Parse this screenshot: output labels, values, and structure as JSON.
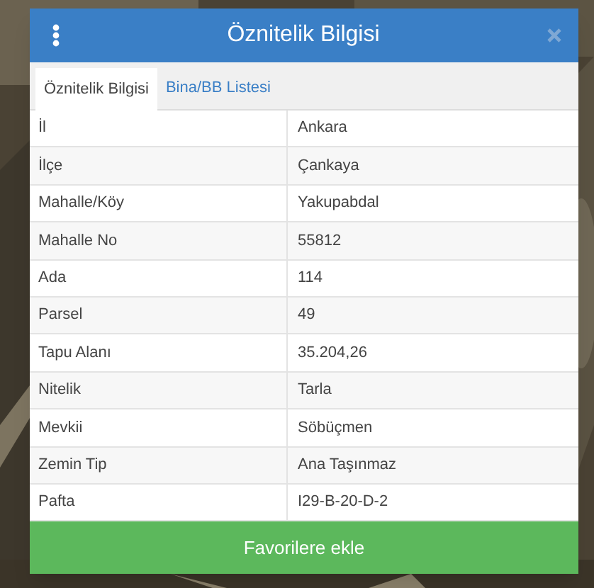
{
  "dialog": {
    "title": "Öznitelik Bilgisi"
  },
  "tabs": [
    {
      "label": "Öznitelik Bilgisi",
      "selected": true
    },
    {
      "label": "Bina/BB Listesi",
      "selected": false
    }
  ],
  "table": {
    "rows": [
      {
        "label": "İl",
        "value": "Ankara"
      },
      {
        "label": "İlçe",
        "value": "Çankaya"
      },
      {
        "label": "Mahalle/Köy",
        "value": "Yakupabdal"
      },
      {
        "label": "Mahalle No",
        "value": "55812"
      },
      {
        "label": "Ada",
        "value": "114"
      },
      {
        "label": "Parsel",
        "value": "49"
      },
      {
        "label": "Tapu Alanı",
        "value": "35.204,26"
      },
      {
        "label": "Nitelik",
        "value": "Tarla"
      },
      {
        "label": "Mevkii",
        "value": "Söbüçmen"
      },
      {
        "label": "Zemin Tip",
        "value": "Ana Taşınmaz"
      },
      {
        "label": "Pafta",
        "value": "I29-B-20-D-2"
      }
    ]
  },
  "button": {
    "label": "Favorilere ekle"
  }
}
